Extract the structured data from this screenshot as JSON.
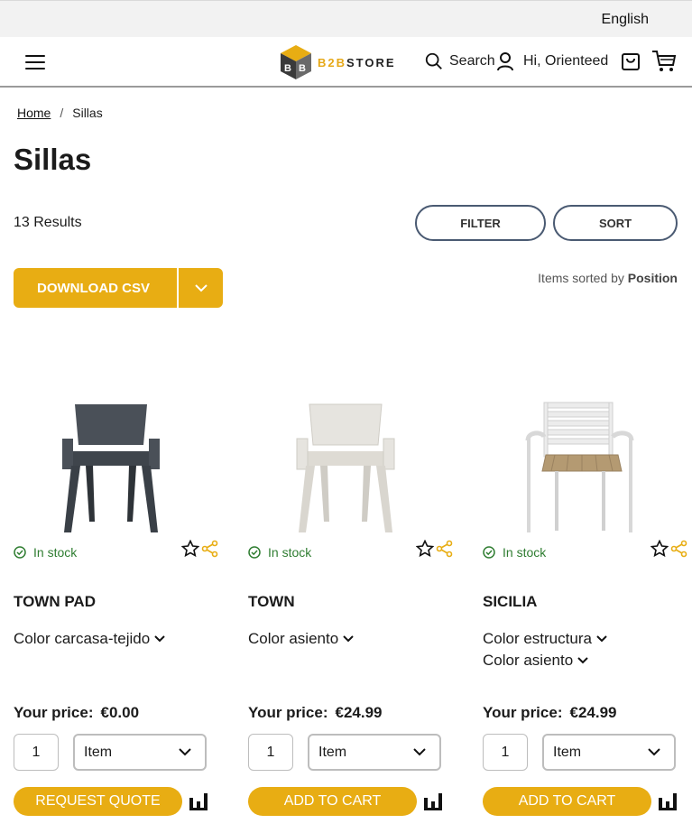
{
  "topbar": {
    "language": "English"
  },
  "header": {
    "logo_prefix": "B2B",
    "logo_suffix": "STORE",
    "search_label": "Search",
    "greeting": "Hi, Orienteed"
  },
  "breadcrumb": {
    "home": "Home",
    "separator": "/",
    "current": "Sillas"
  },
  "page_title": "Sillas",
  "toolbar": {
    "results": "13 Results",
    "filter": "FILTER",
    "sort": "SORT",
    "csv": "DOWNLOAD CSV",
    "sorted_by_label": "Items sorted by",
    "sorted_by_value": "Position"
  },
  "colors": {
    "accent": "#e8ad13",
    "stock": "#2f7d31",
    "pill_border": "#4a5a72"
  },
  "products": [
    {
      "stock": "In stock",
      "name": "TOWN PAD",
      "options": [
        "Color carcasa-tejido"
      ],
      "price_label": "Your price:",
      "price": "€0.00",
      "qty": "1",
      "unit": "Item",
      "cta": "REQUEST QUOTE",
      "chair_color": "#4a5058"
    },
    {
      "stock": "In stock",
      "name": "TOWN",
      "options": [
        "Color asiento"
      ],
      "price_label": "Your price:",
      "price": "€24.99",
      "qty": "1",
      "unit": "Item",
      "cta": "ADD TO CART",
      "chair_color": "#e4e2dc"
    },
    {
      "stock": "In stock",
      "name": "SICILIA",
      "options": [
        "Color estructura",
        "Color asiento"
      ],
      "price_label": "Your price:",
      "price": "€24.99",
      "qty": "1",
      "unit": "Item",
      "cta": "ADD TO CART",
      "chair_color": "#e6e6e6"
    }
  ]
}
